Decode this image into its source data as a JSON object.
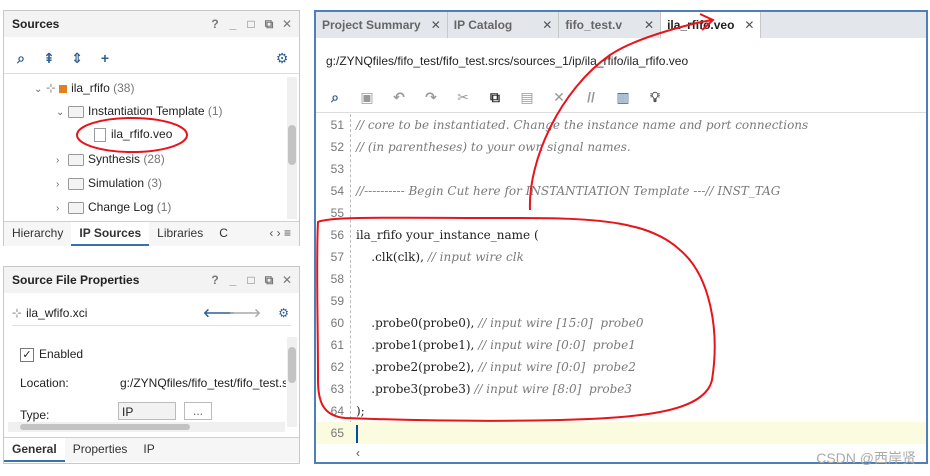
{
  "sources": {
    "title": "Sources",
    "title_controls": [
      "?",
      "_",
      "□",
      "⧉",
      "✕"
    ],
    "tree": [
      {
        "label": "ila_rfifo",
        "count": "(38)"
      },
      {
        "label": "Instantiation Template",
        "count": "(1)"
      },
      {
        "label": "ila_rfifo.veo"
      },
      {
        "label": "Synthesis",
        "count": "(28)"
      },
      {
        "label": "Simulation",
        "count": "(3)"
      },
      {
        "label": "Change Log",
        "count": "(1)"
      }
    ],
    "tabs": [
      "Hierarchy",
      "IP Sources",
      "Libraries",
      "C"
    ],
    "active_tab": "IP Sources"
  },
  "props": {
    "title": "Source File Properties",
    "file": "ila_wfifo.xci",
    "enabled_label": "Enabled",
    "location_label": "Location:",
    "location_value": "g:/ZYNQfiles/fifo_test/fifo_test.s",
    "type_label": "Type:",
    "type_value": "IP",
    "type_more": "...",
    "tabs": [
      "General",
      "Properties",
      "IP"
    ],
    "active_tab": "General"
  },
  "editor": {
    "tabs": [
      {
        "label": "Project Summary"
      },
      {
        "label": "IP Catalog"
      },
      {
        "label": "fifo_test.v"
      },
      {
        "label": "ila_rfifo.veo"
      }
    ],
    "active_tab": "ila_rfifo.veo",
    "path": "g:/ZYNQfiles/fifo_test/fifo_test.srcs/sources_1/ip/ila_rfifo/ila_rfifo.veo",
    "lines": [
      {
        "n": "51",
        "code": "",
        "comment": "// core to be instantiated. Change the instance name and port connections"
      },
      {
        "n": "52",
        "code": "",
        "comment": "// (in parentheses) to your own signal names."
      },
      {
        "n": "53",
        "code": "",
        "comment": ""
      },
      {
        "n": "54",
        "code": "",
        "comment": "//---------- Begin Cut here for INSTANTIATION Template ---// INST_TAG"
      },
      {
        "n": "55",
        "code": "",
        "comment": ""
      },
      {
        "n": "56",
        "code": "ila_rfifo your_instance_name (",
        "comment": ""
      },
      {
        "n": "57",
        "code": "    .clk(clk), ",
        "comment": "// input wire clk"
      },
      {
        "n": "58",
        "code": "",
        "comment": ""
      },
      {
        "n": "59",
        "code": "",
        "comment": ""
      },
      {
        "n": "60",
        "code": "    .probe0(probe0), ",
        "comment": "// input wire [15:0]  probe0"
      },
      {
        "n": "61",
        "code": "    .probe1(probe1), ",
        "comment": "// input wire [0:0]  probe1"
      },
      {
        "n": "62",
        "code": "    .probe2(probe2), ",
        "comment": "// input wire [0:0]  probe2"
      },
      {
        "n": "63",
        "code": "    .probe3(probe3) ",
        "comment": "// input wire [8:0]  probe3"
      },
      {
        "n": "64",
        "code": ");",
        "comment": ""
      },
      {
        "n": "65",
        "code": "",
        "comment": ""
      }
    ]
  },
  "watermark": "CSDN @西岸贤",
  "colors": {
    "annotation_red": "#e8141c",
    "current_line": "#fbfbe0",
    "accent": "#2f5f93"
  }
}
